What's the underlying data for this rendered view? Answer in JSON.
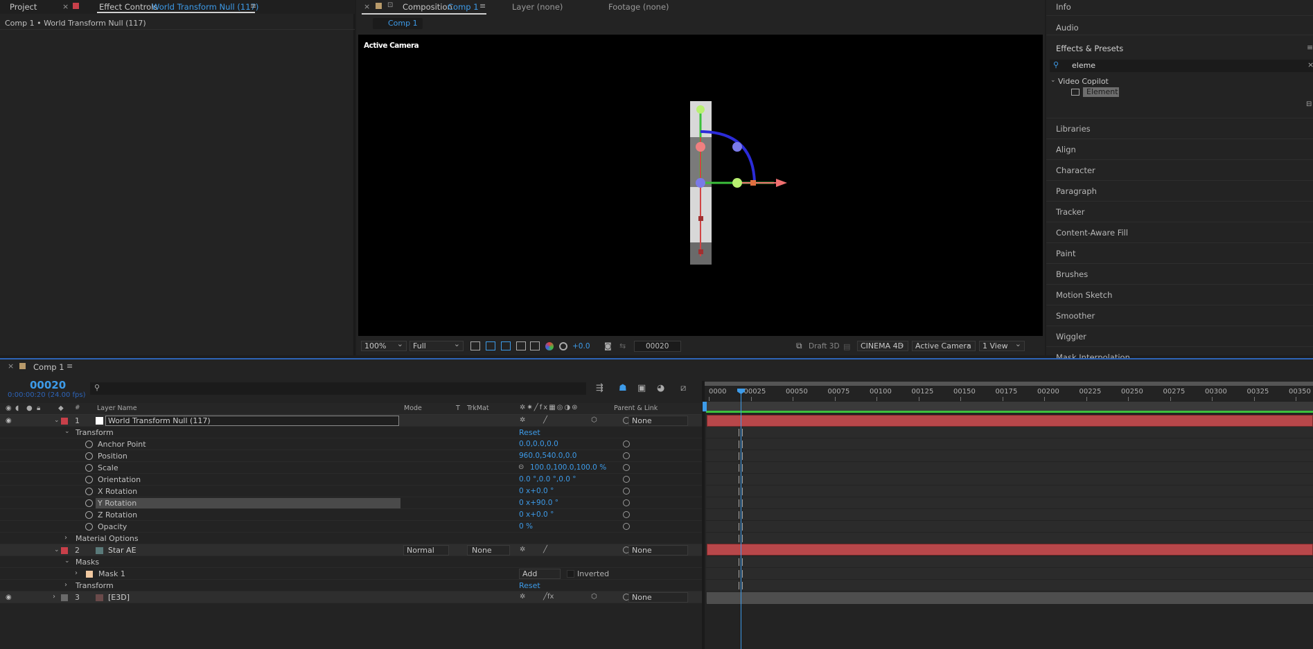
{
  "left": {
    "tab_project": "Project",
    "tab_effect_controls": "Effect Controls",
    "tab_effect_target": "World Transform Null (117)",
    "breadcrumb": "Comp 1 • World Transform Null (117)"
  },
  "comp": {
    "tab_composition": "Composition",
    "tab_comp_name": "Comp 1",
    "tab_layer": "Layer (none)",
    "tab_footage": "Footage (none)",
    "subtab": "Comp 1",
    "active_camera": "Active Camera",
    "zoom": "100%",
    "resolution": "Full",
    "exposure": "+0.0",
    "timecode": "00020",
    "draft3d": "Draft 3D",
    "renderer": "CINEMA 4D",
    "camera": "Active Camera",
    "views": "1 View"
  },
  "right": {
    "info": "Info",
    "audio": "Audio",
    "effects_presets": "Effects & Presets",
    "search_value": "eleme",
    "category": "Video Copilot",
    "effect": "Element",
    "panels": [
      "Libraries",
      "Align",
      "Character",
      "Paragraph",
      "Tracker",
      "Content-Aware Fill",
      "Paint",
      "Brushes",
      "Motion Sketch",
      "Smoother",
      "Wiggler",
      "Mask Interpolation"
    ]
  },
  "timeline": {
    "tab": "Comp 1",
    "current_frame": "00020",
    "timecode_sub": "0:00:00:20 (24.00 fps)",
    "col_layer_name": "Layer Name",
    "col_mode": "Mode",
    "col_t": "T",
    "col_trkmat": "TrkMat",
    "col_parent": "Parent & Link",
    "ruler": [
      "0000",
      "00025",
      "00050",
      "00075",
      "00100",
      "00125",
      "00150",
      "00175",
      "00200",
      "00225",
      "00250",
      "00275",
      "00300",
      "00325",
      "00350"
    ],
    "layer1": {
      "num": "1",
      "name": "World Transform Null (117)",
      "parent": "None"
    },
    "transform": "Transform",
    "reset": "Reset",
    "props": [
      {
        "name": "Anchor Point",
        "value": "0.0,0.0,0.0"
      },
      {
        "name": "Position",
        "value": "960.0,540.0,0.0"
      },
      {
        "name": "Scale",
        "value": "100.0,100.0,100.0 %"
      },
      {
        "name": "Orientation",
        "value": "0.0 °,0.0 °,0.0 °"
      },
      {
        "name": "X Rotation",
        "value": "0 x+0.0 °"
      },
      {
        "name": "Y Rotation",
        "value": "0 x+90.0 °"
      },
      {
        "name": "Z Rotation",
        "value": "0 x+0.0 °"
      },
      {
        "name": "Opacity",
        "value": "0 %"
      }
    ],
    "material_options": "Material Options",
    "layer2": {
      "num": "2",
      "name": "Star AE",
      "mode": "Normal",
      "trkmat": "None",
      "parent": "None"
    },
    "masks": "Masks",
    "mask1": "Mask 1",
    "mask_mode": "Add",
    "inverted": "Inverted",
    "transform2": "Transform",
    "reset2": "Reset",
    "layer3": {
      "num": "3",
      "name": "[E3D]",
      "parent": "None"
    }
  }
}
